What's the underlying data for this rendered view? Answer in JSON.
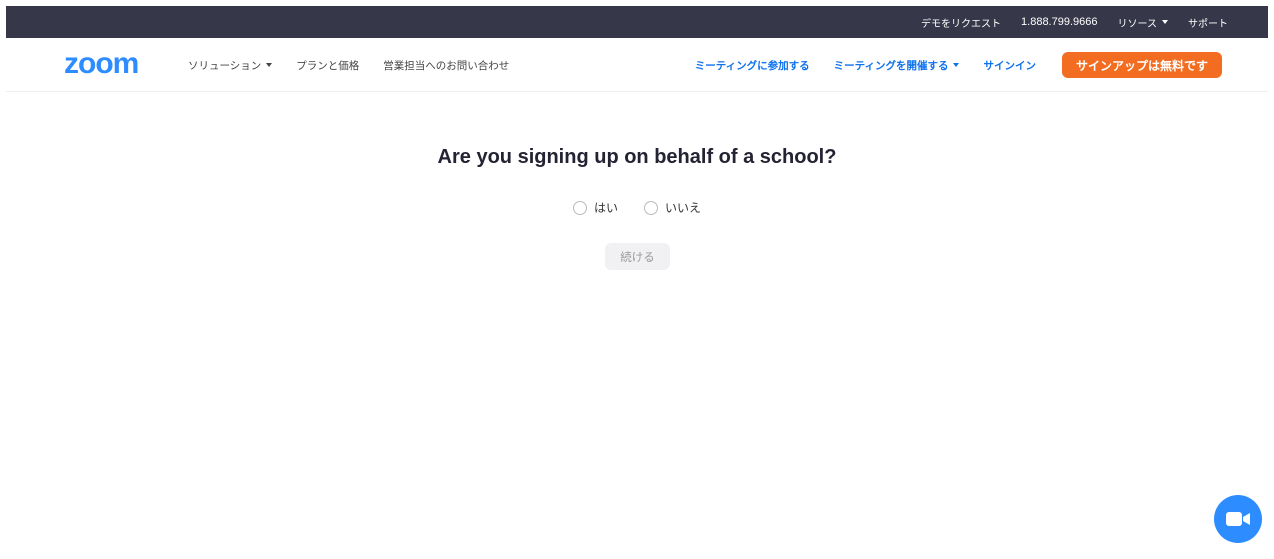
{
  "topbar": {
    "request_demo": "デモをリクエスト",
    "phone": "1.888.799.9666",
    "resources": "リソース",
    "support": "サポート"
  },
  "nav": {
    "logo": "zoom",
    "solutions": "ソリューション",
    "plans": "プランと価格",
    "contact_sales": "営業担当へのお問い合わせ",
    "join_meeting": "ミーティングに参加する",
    "host_meeting": "ミーティングを開催する",
    "sign_in": "サインイン",
    "sign_up": "サインアップは無料です"
  },
  "form": {
    "question": "Are you signing up on behalf of a school?",
    "options": [
      "はい",
      "いいえ"
    ],
    "continue_label": "続ける"
  },
  "colors": {
    "topbar_bg": "#37374a",
    "brand_blue": "#2d8cff",
    "link_blue": "#0e72ed",
    "signup_orange": "#f26d21"
  },
  "icons": {
    "fab": "video-camera-icon"
  }
}
